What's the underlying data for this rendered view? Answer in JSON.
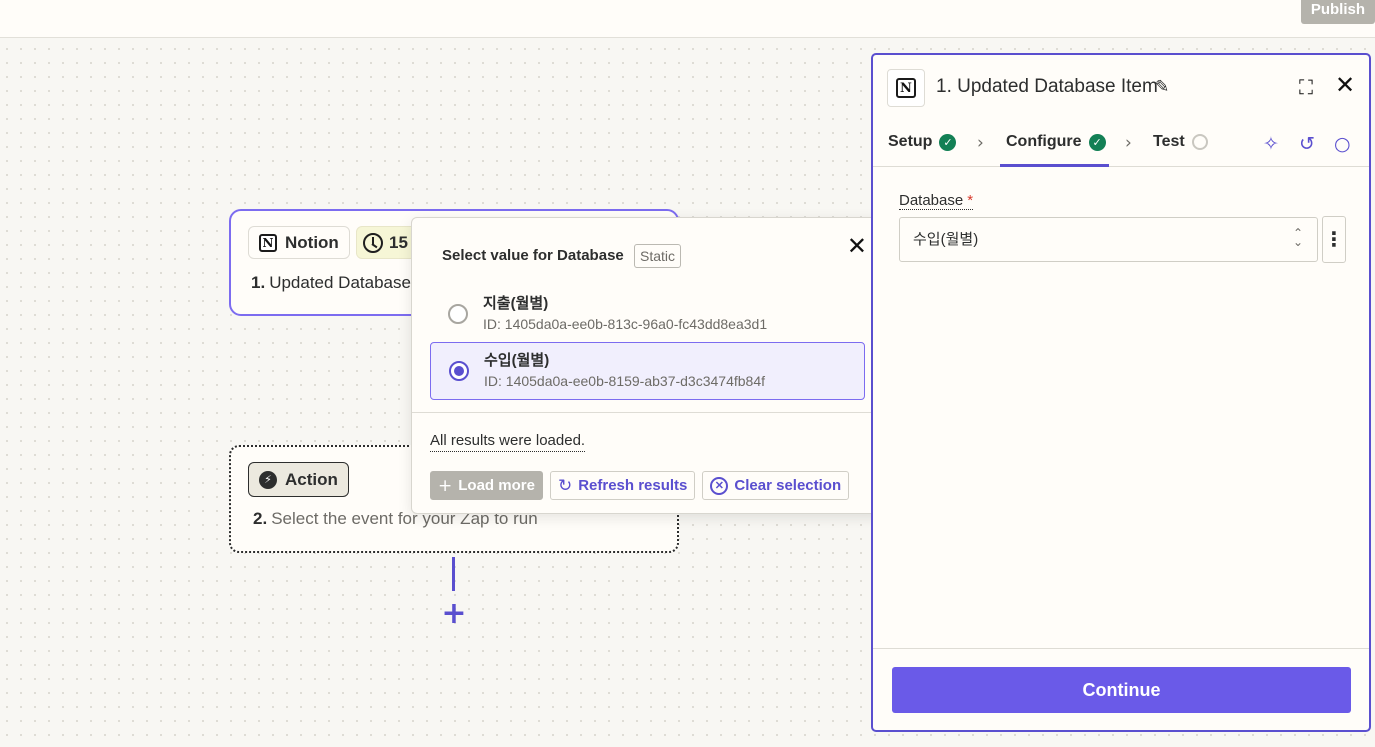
{
  "topbar": {
    "publish_label": "Publish"
  },
  "trigger_step": {
    "app_name": "Notion",
    "poll_interval": "15",
    "number": "1.",
    "title": "Updated Database"
  },
  "action_step": {
    "chip_label": "Action",
    "number": "2.",
    "description": "Select the event for your Zap to run"
  },
  "popup": {
    "title": "Select value for Database",
    "mode_badge": "Static",
    "options": [
      {
        "name": "지출(월별)",
        "id": "ID: 1405da0a-ee0b-813c-96a0-fc43dd8ea3d1",
        "selected": false
      },
      {
        "name": "수입(월별)",
        "id": "ID: 1405da0a-ee0b-8159-ab37-d3c3474fb84f",
        "selected": true
      }
    ],
    "status_text": "All results were loaded.",
    "load_more_label": "Load more",
    "refresh_label": "Refresh results",
    "clear_label": "Clear selection"
  },
  "panel": {
    "title": "1. Updated Database Item",
    "tabs": [
      {
        "label": "Setup",
        "status": "complete"
      },
      {
        "label": "Configure",
        "status": "complete"
      },
      {
        "label": "Test",
        "status": "pending"
      }
    ],
    "active_tab": "Configure",
    "field": {
      "label": "Database",
      "required_marker": "*",
      "value": "수입(월별)"
    },
    "continue_label": "Continue"
  },
  "colors": {
    "accent": "#5a4fcf",
    "primary_button": "#6a5ae8",
    "success": "#138055",
    "required": "#d8382a"
  }
}
